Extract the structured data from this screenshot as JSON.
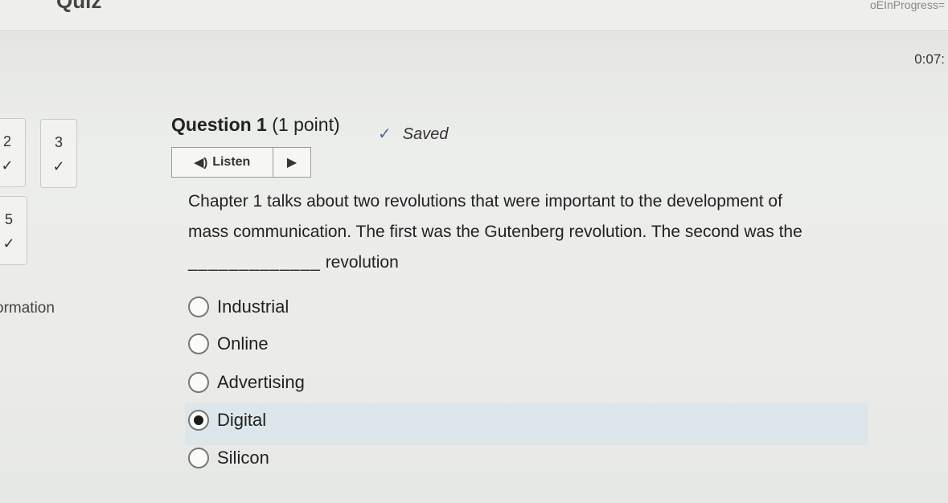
{
  "header": {
    "title": "Quiz",
    "url_fragment": "oEInProgress=",
    "timer": "0:07:"
  },
  "navigator": {
    "tiles": [
      {
        "number": "2",
        "status": "answered"
      },
      {
        "number": "3",
        "status": "answered"
      },
      {
        "number": "5",
        "status": "answered"
      }
    ],
    "side_label": "ormation"
  },
  "question": {
    "title": "Question 1",
    "points": "(1 point)",
    "saved_label": "Saved",
    "listen_label": "Listen",
    "text_line1": "Chapter 1 talks about two revolutions that were important to the development of",
    "text_line2": "mass communication. The first was the Gutenberg revolution. The second was the",
    "blank": "_____________",
    "text_line3": "revolution"
  },
  "options": [
    {
      "label": "Industrial",
      "selected": false
    },
    {
      "label": "Online",
      "selected": false
    },
    {
      "label": "Advertising",
      "selected": false
    },
    {
      "label": "Digital",
      "selected": true
    },
    {
      "label": "Silicon",
      "selected": false
    }
  ],
  "icons": {
    "check": "check-icon",
    "speaker": "speaker-icon",
    "play": "play-icon"
  }
}
